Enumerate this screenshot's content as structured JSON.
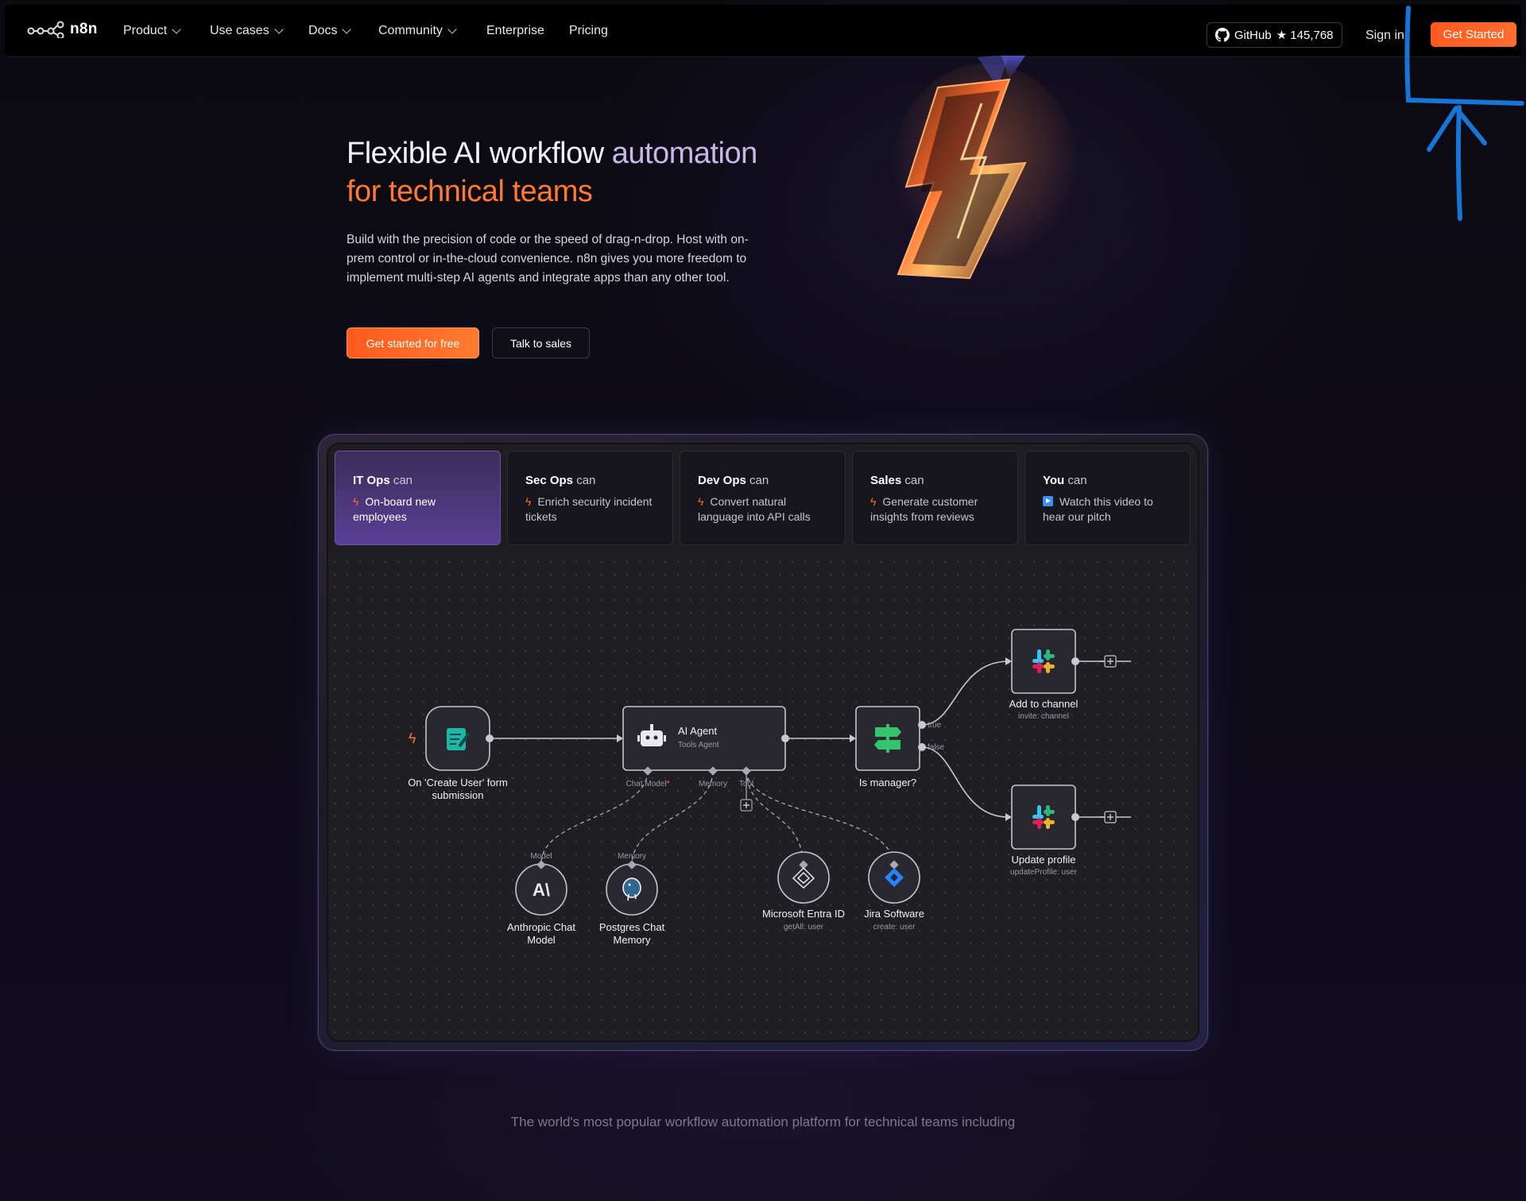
{
  "nav": {
    "brand": "n8n",
    "items": [
      {
        "label": "Product",
        "has_dropdown": true
      },
      {
        "label": "Use cases",
        "has_dropdown": true
      },
      {
        "label": "Docs",
        "has_dropdown": true
      },
      {
        "label": "Community",
        "has_dropdown": true
      },
      {
        "label": "Enterprise",
        "has_dropdown": false
      },
      {
        "label": "Pricing",
        "has_dropdown": false
      }
    ],
    "github_label": "GitHub",
    "github_stars": "★ 145,768",
    "signin": "Sign in",
    "get_started": "Get Started"
  },
  "hero": {
    "title_part1": "Flexible AI workflow",
    "title_part2": " automation",
    "title_line2": "for technical teams",
    "description": "Build with the precision of code or the speed of drag-n-drop. Host with on-prem control or in-the-cloud convenience. n8n gives you more freedom to implement multi-step AI agents and integrate apps than any other tool.",
    "cta_primary": "Get started for free",
    "cta_secondary": "Talk to sales"
  },
  "tabs": [
    {
      "team": "IT Ops",
      "can": " can",
      "icon": "bolt-icon",
      "text": "On-board new employees",
      "active": true
    },
    {
      "team": "Sec Ops",
      "can": " can",
      "icon": "bolt-icon",
      "text": "Enrich security incident tickets",
      "active": false
    },
    {
      "team": "Dev Ops",
      "can": " can",
      "icon": "bolt-icon",
      "text": "Convert natural language into API calls",
      "active": false
    },
    {
      "team": "Sales",
      "can": " can",
      "icon": "bolt-icon",
      "text": "Generate customer insights from reviews",
      "active": false
    },
    {
      "team": "You",
      "can": " can",
      "icon": "play-icon",
      "text": "Watch this video to hear our pitch",
      "active": false
    }
  ],
  "workflow": {
    "trigger": {
      "label1": "On 'Create User' form",
      "label2": "submission"
    },
    "agent": {
      "title": "AI Agent",
      "subtitle": "Tools Agent",
      "port_chat": "Chat Model",
      "port_chat_required": "*",
      "port_memory": "Memory",
      "port_tool": "Tool"
    },
    "if_node": {
      "label": "Is manager?",
      "true_label": "true",
      "false_label": "false"
    },
    "slack1": {
      "label": "Add to channel",
      "sub": "invite: channel"
    },
    "slack2": {
      "label": "Update profile",
      "sub": "updateProfile: user"
    },
    "anthropic": {
      "port": "Model",
      "label1": "Anthropic Chat",
      "label2": "Model"
    },
    "postgres": {
      "port": "Memory",
      "label1": "Postgres Chat",
      "label2": "Memory"
    },
    "entra": {
      "label": "Microsoft Entra ID",
      "sub": "getAll: user"
    },
    "jira": {
      "label": "Jira Software",
      "sub": "create: user"
    }
  },
  "tagline": "The world's most popular workflow automation platform for technical teams including",
  "colors": {
    "accent_orange": "#ff6d2e",
    "active_tab": "#5a3f95",
    "annotation_blue": "#1676d8"
  }
}
